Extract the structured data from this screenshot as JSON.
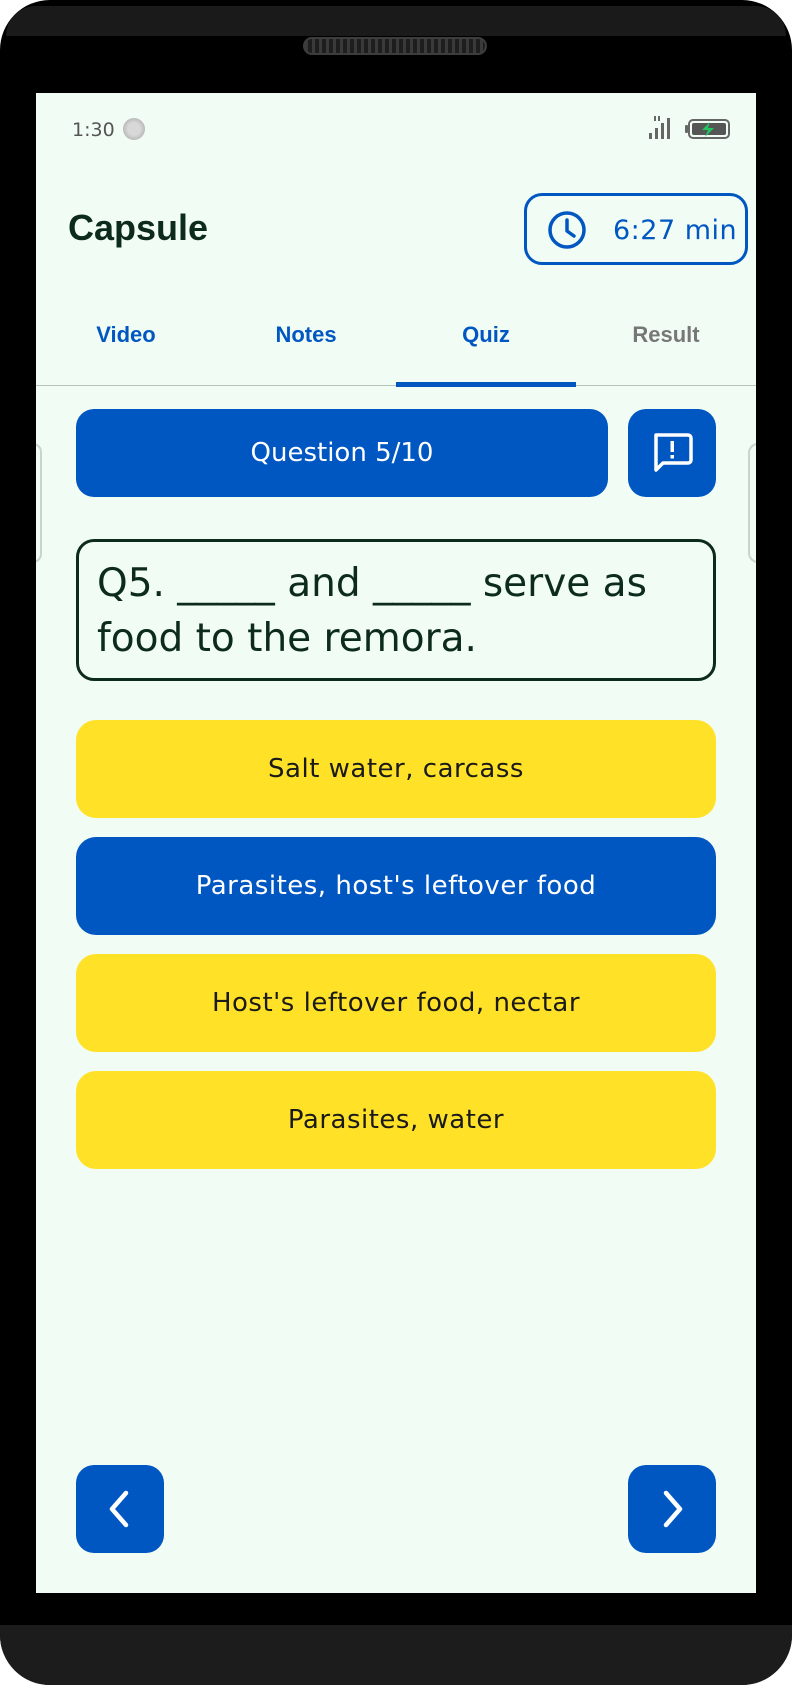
{
  "status_bar": {
    "time": "1:30"
  },
  "header": {
    "title": "Capsule",
    "timer": "6:27 min"
  },
  "tabs": [
    {
      "label": "Video"
    },
    {
      "label": "Notes"
    },
    {
      "label": "Quiz"
    },
    {
      "label": "Result"
    }
  ],
  "active_tab": "Quiz",
  "quiz": {
    "counter": "Question 5/10",
    "question": "Q5. _____ and _____ serve as food to the remora.",
    "options": [
      {
        "label": "Salt water, carcass",
        "selected": false
      },
      {
        "label": "Parasites, host's leftover food",
        "selected": true
      },
      {
        "label": "Host's leftover food, nectar",
        "selected": false
      },
      {
        "label": "Parasites, water",
        "selected": false
      }
    ]
  },
  "colors": {
    "primary": "#0057c2",
    "option_yellow": "#ffe228",
    "background": "#f1fdf4",
    "text_dark": "#0d2b1d"
  },
  "icons": {
    "timer": "clock-icon",
    "report": "report-message-icon",
    "prev": "chevron-left-icon",
    "next": "chevron-right-icon"
  }
}
